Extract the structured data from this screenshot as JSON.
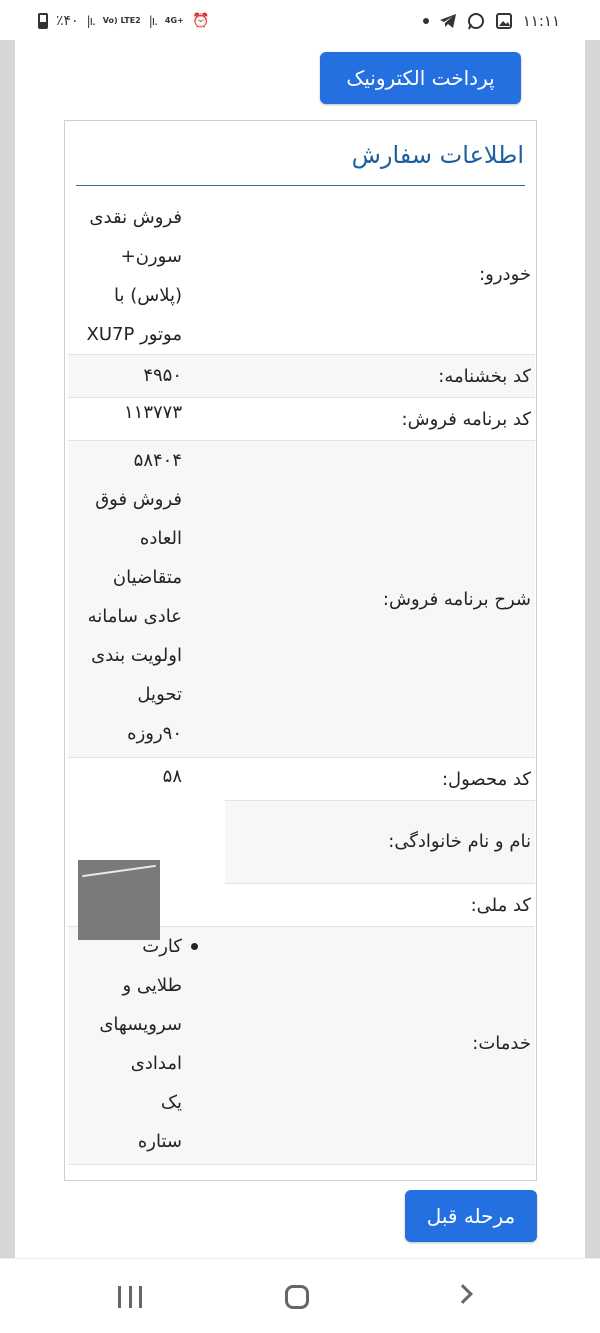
{
  "status_bar": {
    "battery_text": "٪۴۰",
    "network_label": "Vo) LTE2",
    "network_type": "4G+",
    "time": "۱۱:۱۱"
  },
  "buttons": {
    "electronic_payment": "پرداخت الکترونیک",
    "previous_step": "مرحله قبل"
  },
  "order_info": {
    "title": "اطلاعات سفارش",
    "rows": [
      {
        "label": "خودرو:",
        "value_lines": [
          "فروش نقدی",
          "سورن+",
          "(پلاس) با",
          "موتور XU7P"
        ]
      },
      {
        "label": "کد بخشنامه:",
        "value_lines": [
          "۴۹۵۰"
        ]
      },
      {
        "label": "کد برنامه فروش:",
        "value_lines": [
          "۱۱۳۷۷۳"
        ]
      },
      {
        "label": "شرح برنامه فروش:",
        "value_lines": [
          "۵۸۴۰۴",
          "فروش فوق",
          "العاده",
          "متقاضیان",
          "عادی سامانه",
          "اولویت بندی",
          "تحویل",
          "۹۰روزه"
        ]
      },
      {
        "label": "کد محصول:",
        "value_lines": [
          "۵۸"
        ]
      },
      {
        "label": "نام و نام خانوادگی:",
        "value_lines": []
      },
      {
        "label": "کد ملی:",
        "value_lines": []
      },
      {
        "label": "خدمات:",
        "value_lines": [
          "کارت",
          "طلایی و",
          "سرویسهای",
          "امدادی",
          "یک",
          "ستاره"
        ]
      }
    ]
  },
  "colors": {
    "primary_button": "#2470e0",
    "title_color": "#1f5f9e"
  }
}
